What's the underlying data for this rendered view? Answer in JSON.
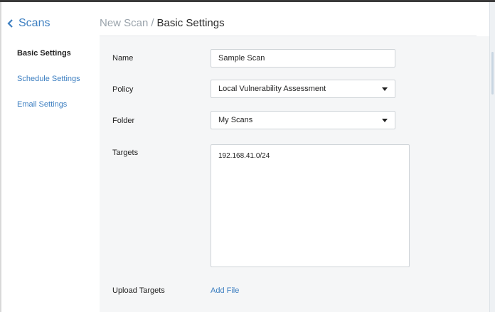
{
  "sidebar": {
    "back_label": "Scans",
    "items": [
      {
        "label": "Basic Settings",
        "active": true
      },
      {
        "label": "Schedule Settings",
        "active": false
      },
      {
        "label": "Email Settings",
        "active": false
      }
    ]
  },
  "breadcrumb": {
    "parent": "New Scan",
    "separator": "/",
    "current": "Basic Settings"
  },
  "form": {
    "name_label": "Name",
    "name_value": "Sample Scan",
    "policy_label": "Policy",
    "policy_value": "Local Vulnerability Assessment",
    "folder_label": "Folder",
    "folder_value": "My Scans",
    "targets_label": "Targets",
    "targets_value": "192.168.41.0/24",
    "upload_label": "Upload Targets",
    "upload_action": "Add File"
  },
  "colors": {
    "link": "#3d7fc1",
    "panel_bg": "#f5f6f7",
    "text": "#222222",
    "muted": "#9aa3ab"
  },
  "icons": {
    "back": "chevron-left-icon",
    "dropdown": "caret-down-icon"
  }
}
